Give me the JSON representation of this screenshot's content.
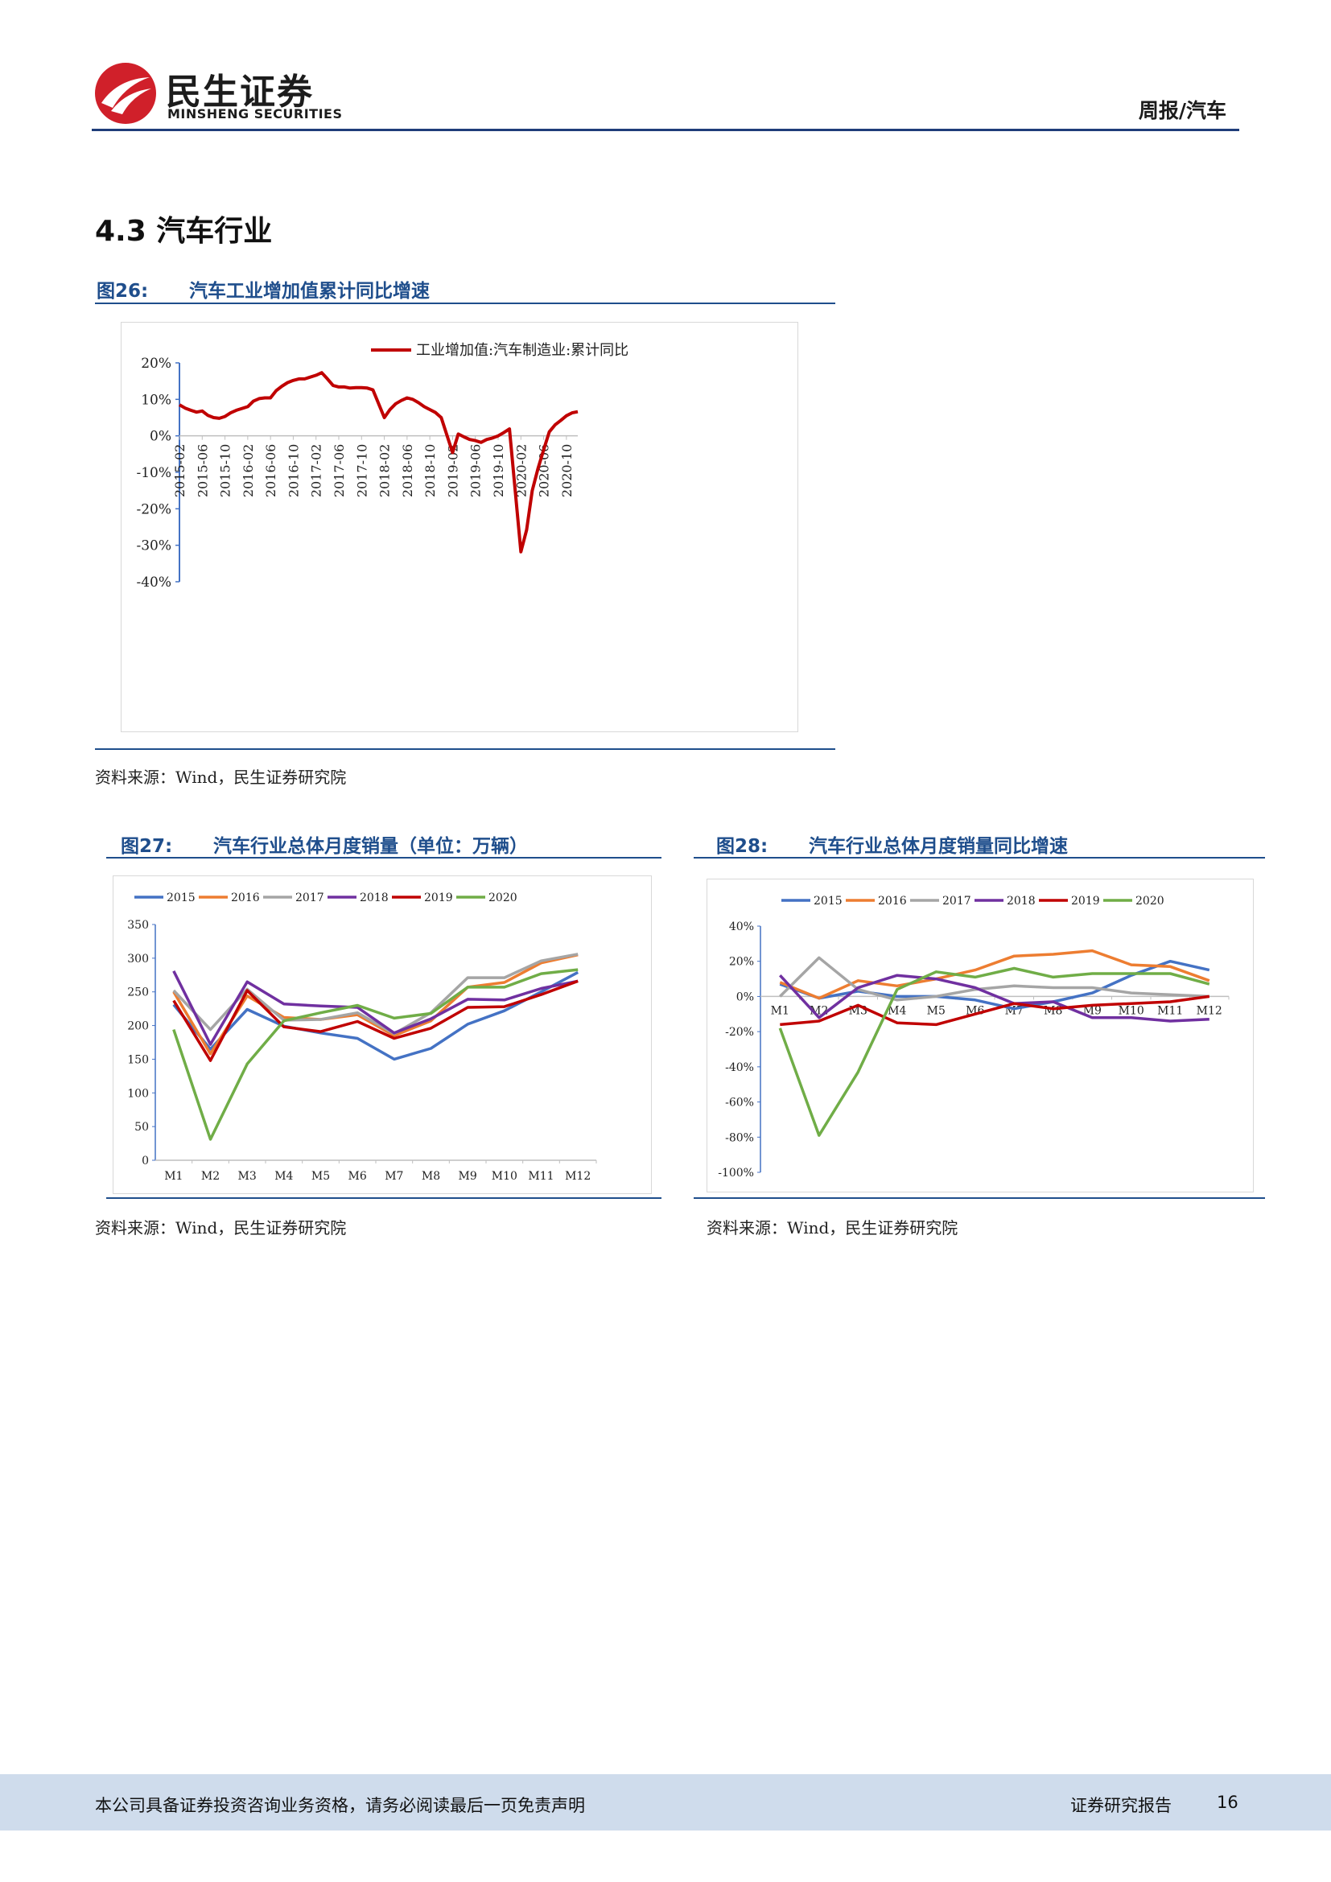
{
  "header": {
    "logo_cn": "民生证券",
    "logo_en": "MINSHENG SECURITIES",
    "report_type": "周报/汽车"
  },
  "section": {
    "title": "4.3 汽车行业"
  },
  "figures": [
    {
      "num": "图26:",
      "title": "汽车工业增加值累计同比增速",
      "source": "资料来源：Wind，民生证券研究院"
    },
    {
      "num": "图27:",
      "title": "汽车行业总体月度销量（单位：万辆）",
      "source": "资料来源：Wind，民生证券研究院"
    },
    {
      "num": "图28:",
      "title": "汽车行业总体月度销量同比增速",
      "source": "资料来源：Wind，民生证券研究院"
    }
  ],
  "footer": {
    "disclaimer": "本公司具备证券投资咨询业务资格，请务必阅读最后一页免责声明",
    "report_label": "证券研究报告",
    "page_number": "16"
  },
  "colors": {
    "brand_blue": "#1f4e8c",
    "logo_red": "#d0202a"
  },
  "chart_data": [
    {
      "type": "line",
      "legend": [
        "工业增加值:汽车制造业:累计同比"
      ],
      "x_tick_labels": [
        "2015-02",
        "2015-06",
        "2015-10",
        "2016-02",
        "2016-06",
        "2016-10",
        "2017-02",
        "2017-06",
        "2017-10",
        "2018-02",
        "2018-06",
        "2018-10",
        "2019-02",
        "2019-06",
        "2019-10",
        "2020-02",
        "2020-06",
        "2020-10"
      ],
      "y_tick_labels": [
        "20%",
        "10%",
        "0%",
        "-10%",
        "-20%",
        "-30%",
        "-40%"
      ],
      "ylim": [
        -40,
        20
      ],
      "series": [
        {
          "color": "#c00000",
          "x": [
            "2015-02",
            "2015-03",
            "2015-04",
            "2015-05",
            "2015-06",
            "2015-07",
            "2015-08",
            "2015-09",
            "2015-10",
            "2015-11",
            "2015-12",
            "2016-02",
            "2016-03",
            "2016-04",
            "2016-05",
            "2016-06",
            "2016-07",
            "2016-08",
            "2016-09",
            "2016-10",
            "2016-11",
            "2016-12",
            "2017-02",
            "2017-03",
            "2017-04",
            "2017-05",
            "2017-06",
            "2017-07",
            "2017-08",
            "2017-09",
            "2017-10",
            "2017-11",
            "2017-12",
            "2018-02",
            "2018-03",
            "2018-04",
            "2018-05",
            "2018-06",
            "2018-07",
            "2018-08",
            "2018-09",
            "2018-10",
            "2018-11",
            "2018-12",
            "2019-02",
            "2019-03",
            "2019-04",
            "2019-05",
            "2019-06",
            "2019-07",
            "2019-08",
            "2019-09",
            "2019-10",
            "2019-11",
            "2019-12",
            "2020-02",
            "2020-03",
            "2020-04",
            "2020-05",
            "2020-06",
            "2020-07",
            "2020-08",
            "2020-09",
            "2020-10",
            "2020-11",
            "2020-12"
          ],
          "values": [
            8.5,
            7.6,
            7.0,
            6.5,
            6.8,
            5.6,
            5.0,
            4.8,
            5.3,
            6.3,
            7.0,
            8.0,
            9.5,
            10.2,
            10.4,
            10.4,
            12.4,
            13.6,
            14.6,
            15.2,
            15.6,
            15.6,
            16.6,
            17.3,
            15.6,
            13.8,
            13.4,
            13.4,
            13.1,
            13.2,
            13.2,
            13.1,
            12.6,
            5.0,
            7.2,
            8.8,
            9.7,
            10.4,
            10.0,
            9.1,
            8.0,
            7.2,
            6.4,
            5.0,
            -4.6,
            0.5,
            -0.3,
            -1.0,
            -1.3,
            -1.8,
            -1.0,
            -0.6,
            0.0,
            0.9,
            1.9,
            -31.8,
            -25.8,
            -15.0,
            -9.0,
            -3.8,
            1.1,
            3.0,
            4.2,
            5.5,
            6.3,
            6.6
          ]
        }
      ]
    },
    {
      "type": "line",
      "categories": [
        "M1",
        "M2",
        "M3",
        "M4",
        "M5",
        "M6",
        "M7",
        "M8",
        "M9",
        "M10",
        "M11",
        "M12"
      ],
      "y_tick_labels": [
        "350",
        "300",
        "250",
        "200",
        "150",
        "100",
        "50",
        "0"
      ],
      "ylim": [
        0,
        350
      ],
      "series": [
        {
          "name": "2015",
          "color": "#4472c4",
          "values": [
            231,
            165,
            224,
            199,
            189,
            181,
            150,
            166,
            202,
            222,
            250,
            279
          ]
        },
        {
          "name": "2016",
          "color": "#ed7d31",
          "values": [
            250,
            158,
            244,
            212,
            209,
            216,
            185,
            207,
            257,
            264,
            293,
            305
          ]
        },
        {
          "name": "2017",
          "color": "#a5a5a5",
          "values": [
            252,
            194,
            254,
            208,
            209,
            219,
            188,
            219,
            271,
            271,
            296,
            306
          ]
        },
        {
          "name": "2018",
          "color": "#7030a0",
          "values": [
            281,
            172,
            265,
            232,
            229,
            227,
            189,
            210,
            239,
            238,
            255,
            266
          ]
        },
        {
          "name": "2019",
          "color": "#c00000",
          "values": [
            237,
            148,
            252,
            198,
            191,
            206,
            181,
            196,
            227,
            228,
            246,
            266
          ]
        },
        {
          "name": "2020",
          "color": "#70ad47",
          "values": [
            194,
            31,
            143,
            207,
            219,
            230,
            211,
            218,
            257,
            257,
            277,
            283
          ]
        }
      ]
    },
    {
      "type": "line",
      "categories": [
        "M1",
        "M2",
        "M3",
        "M4",
        "M5",
        "M6",
        "M7",
        "M8",
        "M9",
        "M10",
        "M11",
        "M12"
      ],
      "y_tick_labels": [
        "40%",
        "20%",
        "0%",
        "-20%",
        "-40%",
        "-60%",
        "-80%",
        "-100%"
      ],
      "ylim": [
        -100,
        40
      ],
      "series": [
        {
          "name": "2015",
          "color": "#4472c4",
          "values": [
            7,
            -1,
            3,
            0,
            0,
            -2,
            -7,
            -3,
            2,
            12,
            20,
            15
          ]
        },
        {
          "name": "2016",
          "color": "#ed7d31",
          "values": [
            8,
            -1,
            9,
            6,
            10,
            15,
            23,
            24,
            26,
            18,
            17,
            9
          ]
        },
        {
          "name": "2017",
          "color": "#a5a5a5",
          "values": [
            0,
            22,
            4,
            -2,
            0,
            4,
            6,
            5,
            5,
            2,
            1,
            0
          ]
        },
        {
          "name": "2018",
          "color": "#7030a0",
          "values": [
            12,
            -12,
            5,
            12,
            10,
            5,
            -4,
            -3,
            -12,
            -12,
            -14,
            -13
          ]
        },
        {
          "name": "2019",
          "color": "#c00000",
          "values": [
            -16,
            -14,
            -5,
            -15,
            -16,
            -10,
            -4,
            -7,
            -5,
            -4,
            -3,
            0
          ]
        },
        {
          "name": "2020",
          "color": "#70ad47",
          "values": [
            -18,
            -79,
            -43,
            4,
            14,
            11,
            16,
            11,
            13,
            13,
            13,
            7
          ]
        }
      ]
    }
  ]
}
